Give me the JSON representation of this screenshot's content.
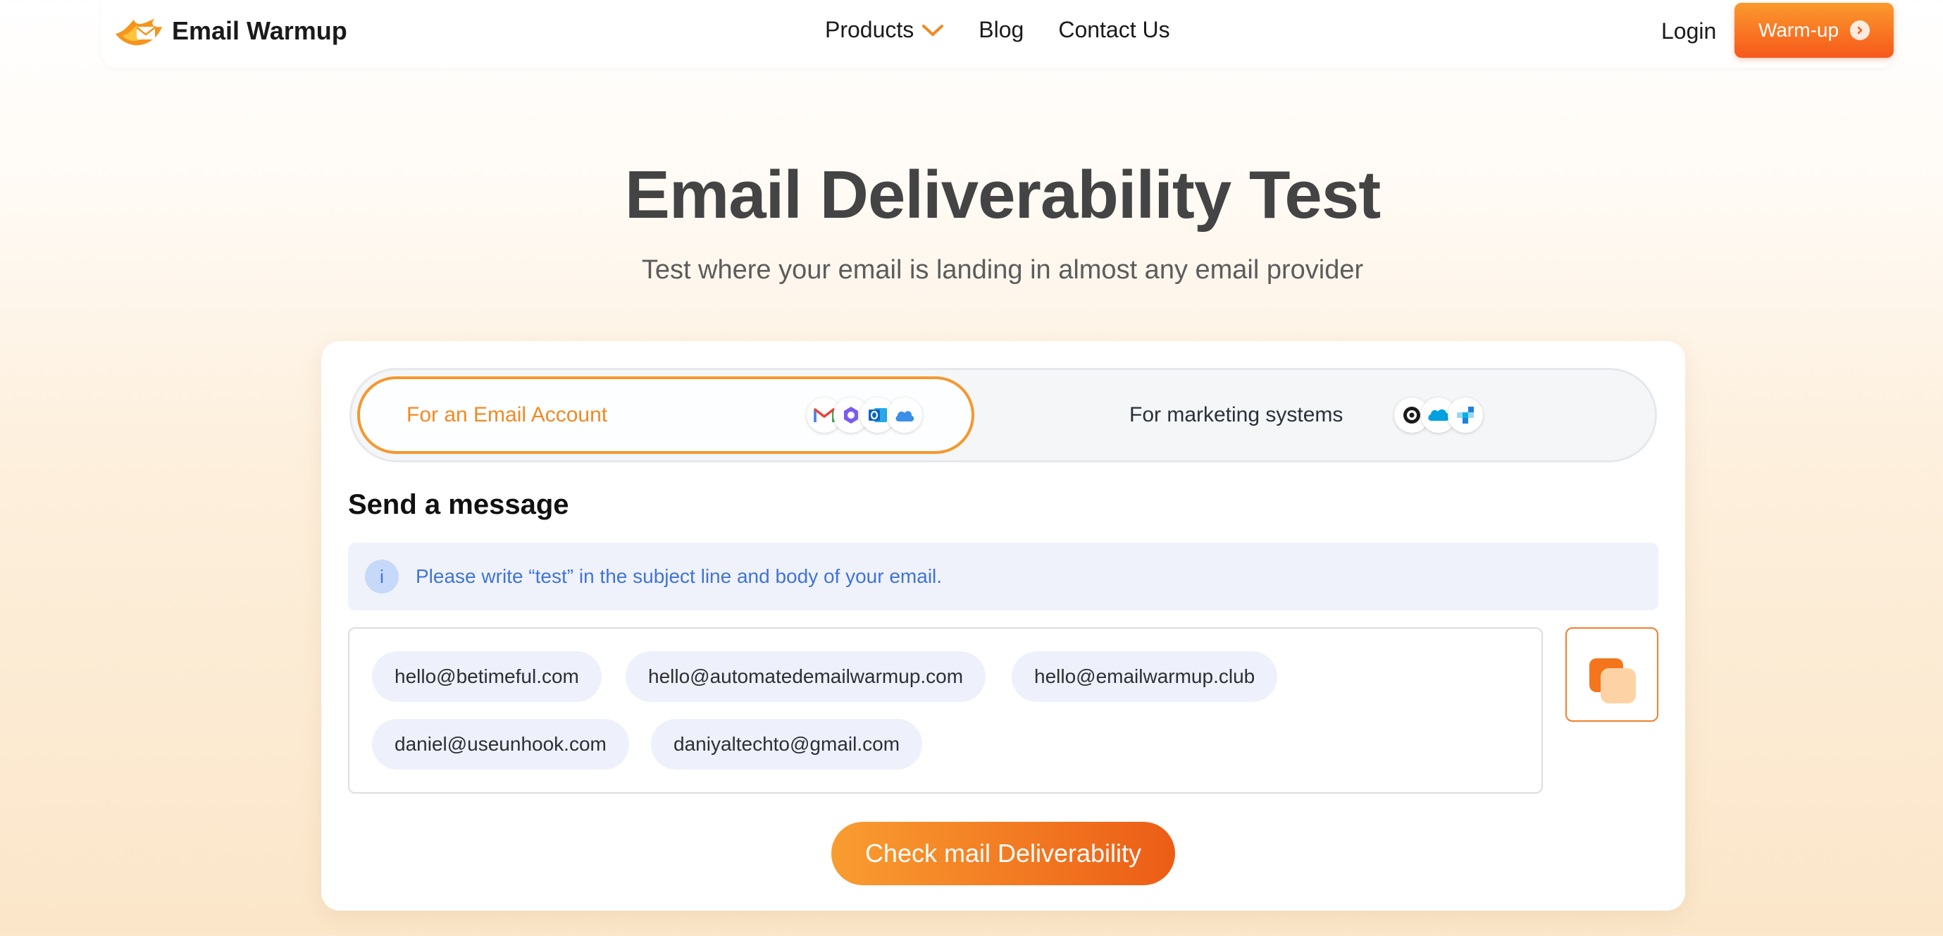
{
  "header": {
    "logo_text": "Email Warmup",
    "nav": {
      "products": "Products",
      "blog": "Blog",
      "contact": "Contact Us"
    },
    "login": "Login",
    "cta": "Warm-up"
  },
  "hero": {
    "title": "Email Deliverability Test",
    "subtitle": "Test where your email is landing in almost any email provider"
  },
  "tabs": {
    "email_account": {
      "label": "For an Email Account",
      "icons": [
        "gmail-icon",
        "proton-icon",
        "outlook-icon",
        "icloud-icon"
      ]
    },
    "marketing": {
      "label": "For marketing systems",
      "icons": [
        "mailchimp-icon",
        "salesforce-icon",
        "sendgrid-icon"
      ]
    }
  },
  "send": {
    "title": "Send a message",
    "info_icon": "i",
    "info_text": "Please write “test” in the subject line and body of your email."
  },
  "emails": [
    "hello@betimeful.com",
    "hello@automatedemailwarmup.com",
    "hello@emailwarmup.club",
    "daniel@useunhook.com",
    "daniyaltechto@gmail.com"
  ],
  "cta": "Check mail Deliverability",
  "colors": {
    "accent": "#f4982f",
    "accent_dark": "#ec5d16",
    "info_text": "#3f74d8"
  }
}
